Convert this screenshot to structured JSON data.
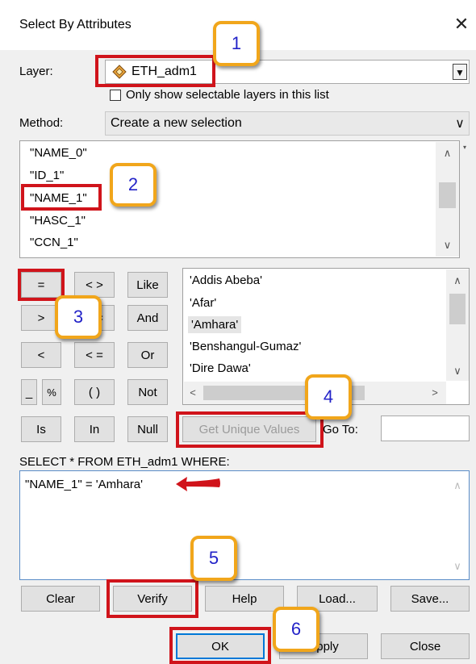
{
  "dialog": {
    "title": "Select By Attributes",
    "close_glyph": "✕"
  },
  "layer": {
    "label": "Layer:",
    "value": "ETH_adm1",
    "dropdown_glyph": "▼",
    "only_selectable_label": "Only show selectable layers in this list",
    "only_selectable_checked": false
  },
  "method": {
    "label": "Method:",
    "value": "Create a new selection",
    "dropdown_glyph": "∨"
  },
  "fields": {
    "items": [
      "\"NAME_0\"",
      "\"ID_1\"",
      "\"NAME_1\"",
      "\"HASC_1\"",
      "\"CCN_1\""
    ],
    "up_glyph": "∧",
    "down_glyph": "∨"
  },
  "operators": {
    "equals": "=",
    "not_equals": "< >",
    "like": "Like",
    "greater": ">",
    "greater_equal": "> =",
    "and": "And",
    "less": "<",
    "less_equal": "< =",
    "or": "Or",
    "underscore": "_",
    "percent": "%",
    "parentheses": "( )",
    "not": "Not",
    "is": "Is",
    "in": "In",
    "null": "Null"
  },
  "values": {
    "items": [
      "'Addis Abeba'",
      "'Afar'",
      "'Amhara'",
      "'Benshangul-Gumaz'",
      "'Dire Dawa'"
    ],
    "selected_index": 2,
    "up_glyph": "∧",
    "down_glyph": "∨",
    "left_glyph": "<",
    "right_glyph": ">"
  },
  "unique_values": {
    "button_label": "Get Unique Values",
    "goto_label": "Go To:",
    "goto_value": ""
  },
  "query": {
    "prefix_label": "SELECT * FROM ETH_adm1 WHERE:",
    "expression": "\"NAME_1\" = 'Amhara'",
    "up_glyph": "∧",
    "down_glyph": "∨"
  },
  "actions": {
    "clear": "Clear",
    "verify": "Verify",
    "help": "Help",
    "load": "Load...",
    "save": "Save..."
  },
  "footer": {
    "ok": "OK",
    "apply": "Apply",
    "close": "Close"
  },
  "annotations": {
    "badges": [
      "1",
      "2",
      "3",
      "4",
      "5",
      "6"
    ],
    "highlight_color": "#d0141b",
    "badge_border_color": "#f1a61b",
    "badge_text_color": "#2323c8"
  }
}
